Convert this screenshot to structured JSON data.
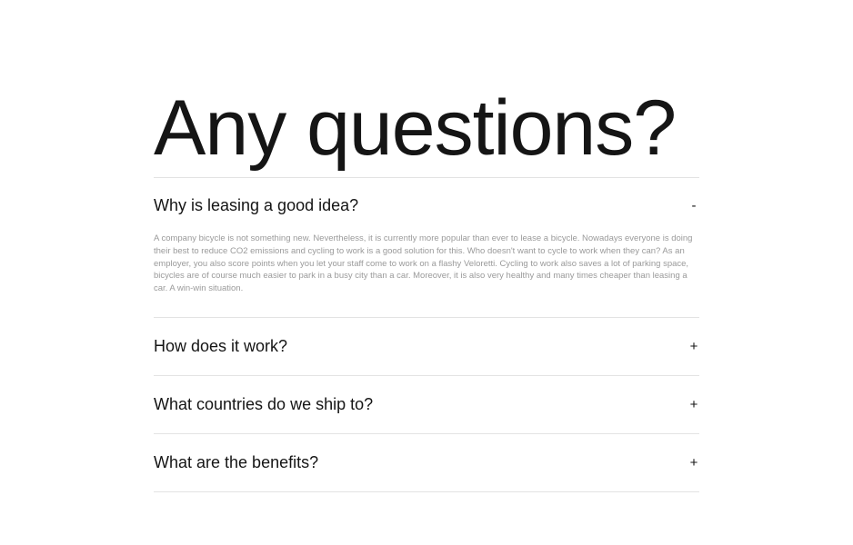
{
  "faq": {
    "title": "Any questions?",
    "items": [
      {
        "question": "Why is leasing a good idea?",
        "toggle": "-",
        "answer": "A company bicycle is not something new. Nevertheless, it is currently more popular than ever to lease a bicycle. Nowadays everyone is doing their best to reduce CO2 emissions and cycling to work is a good solution for this. Who doesn't want to cycle to work when they can? As an employer, you also score points when you let your staff come to work on a flashy Veloretti. Cycling to work also saves a lot of parking space, bicycles are of course much easier to park in a busy city than a car. Moreover, it is also very healthy and many times cheaper than leasing a car. A win-win situation."
      },
      {
        "question": "How does it work?",
        "toggle": "+"
      },
      {
        "question": "What countries do we ship to?",
        "toggle": "+"
      },
      {
        "question": "What are the benefits?",
        "toggle": "+"
      }
    ]
  }
}
